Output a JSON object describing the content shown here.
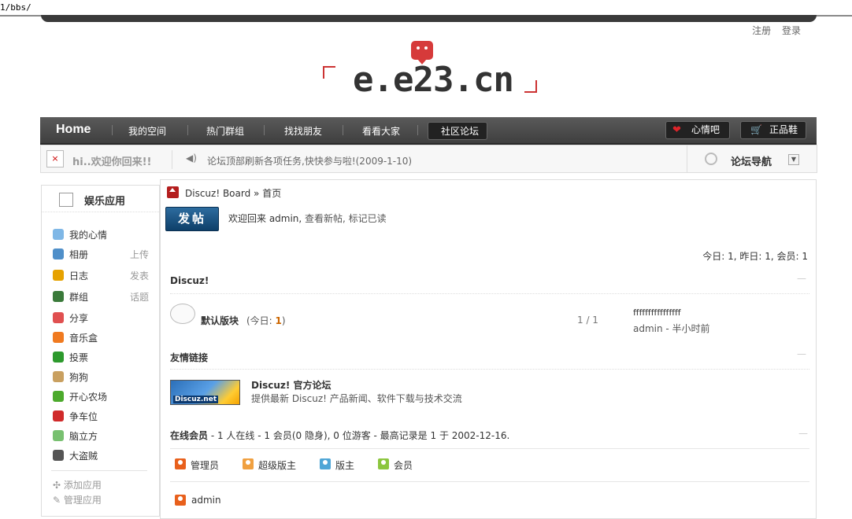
{
  "url": "1/bbs/",
  "top_links": [
    "注册",
    "登录"
  ],
  "logo_text": "e.e23.cn",
  "nav": {
    "home": "Home",
    "items": [
      "我的空间",
      "热门群组",
      "找找朋友",
      "看看大家",
      "社区论坛"
    ],
    "right_buttons": [
      "心情吧",
      "正品鞋"
    ]
  },
  "subbar": {
    "avatar_alt": "×",
    "welcome": "hi..欢迎你回来!!",
    "announcement": "论坛顶部刷新各项任务,快快参与啦!(2009-1-10)",
    "forum_nav": "论坛导航"
  },
  "sidebar": {
    "title": "娱乐应用",
    "items": [
      {
        "label": "我的心情",
        "extra": "",
        "color": "#7fb7e6"
      },
      {
        "label": "相册",
        "extra": "上传",
        "color": "#4f8fc9"
      },
      {
        "label": "日志",
        "extra": "发表",
        "color": "#e6a200"
      },
      {
        "label": "群组",
        "extra": "话题",
        "color": "#3a7a3a"
      },
      {
        "label": "分享",
        "extra": "",
        "color": "#e05050"
      },
      {
        "label": "音乐盒",
        "extra": "",
        "color": "#f07a20"
      },
      {
        "label": "投票",
        "extra": "",
        "color": "#2d9a2d"
      },
      {
        "label": "狗狗",
        "extra": "",
        "color": "#c9a060"
      },
      {
        "label": "开心农场",
        "extra": "",
        "color": "#4caa2c"
      },
      {
        "label": "争车位",
        "extra": "",
        "color": "#d02a2a"
      },
      {
        "label": "脑立方",
        "extra": "",
        "color": "#78c070"
      },
      {
        "label": "大盗贼",
        "extra": "",
        "color": "#555555"
      }
    ],
    "footer": [
      "添加应用",
      "管理应用"
    ]
  },
  "main": {
    "breadcrumb": "Discuz! Board » 首页",
    "post_button": "发帖",
    "welcome_prefix": "欢迎回来 admin, ",
    "welcome_links": "查看新帖, 标记已读",
    "stats": "今日: 1, 昨日: 1, 会员: 1",
    "section_discuz": "Discuz!",
    "collapse": "—",
    "forum": {
      "name": "默认版块",
      "today_label": "(今日: ",
      "today_count": "1",
      "today_close": ")",
      "posts": "1 / 1",
      "last_title": "ffffffffffffffff",
      "last_meta": "admin - 半小时前"
    },
    "section_links": "友情链接",
    "link": {
      "banner": "Discuz.net",
      "title": "Discuz! 官方论坛",
      "desc": "提供最新 Discuz! 产品新闻、软件下载与技术交流"
    },
    "online": {
      "label": "在线会员",
      "text": " - 1 人在线 - 1 会员(0 隐身), 0 位游客 - 最高记录是 1 于 2002-12-16."
    },
    "legend": [
      {
        "label": "管理员",
        "color": "#e8601c"
      },
      {
        "label": "超级版主",
        "color": "#f0a040"
      },
      {
        "label": "版主",
        "color": "#4fa6d6"
      },
      {
        "label": "会员",
        "color": "#8cc63f"
      }
    ],
    "online_user": "admin"
  }
}
